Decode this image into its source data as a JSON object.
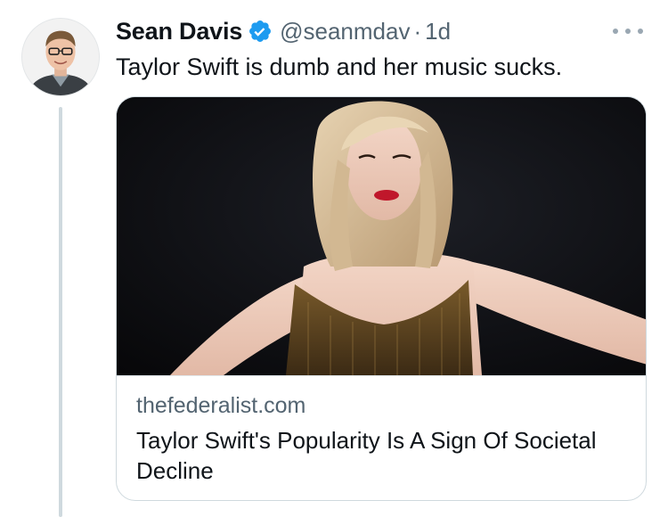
{
  "author": {
    "display_name": "Sean Davis",
    "handle": "@seanmdav",
    "separator": "·",
    "time": "1d",
    "verified": true
  },
  "tweet": {
    "text": "Taylor Swift is dumb and her music sucks."
  },
  "card": {
    "domain": "thefederalist.com",
    "title": "Taylor Swift's Popularity Is A Sign Of Societal Decline"
  },
  "icons": {
    "verified": "verified-badge-icon",
    "more": "more-options-icon"
  },
  "colors": {
    "verified_blue": "#1d9bf0",
    "secondary_text": "#536471",
    "primary_text": "#0f1419",
    "thread_line": "#cfd9de"
  }
}
